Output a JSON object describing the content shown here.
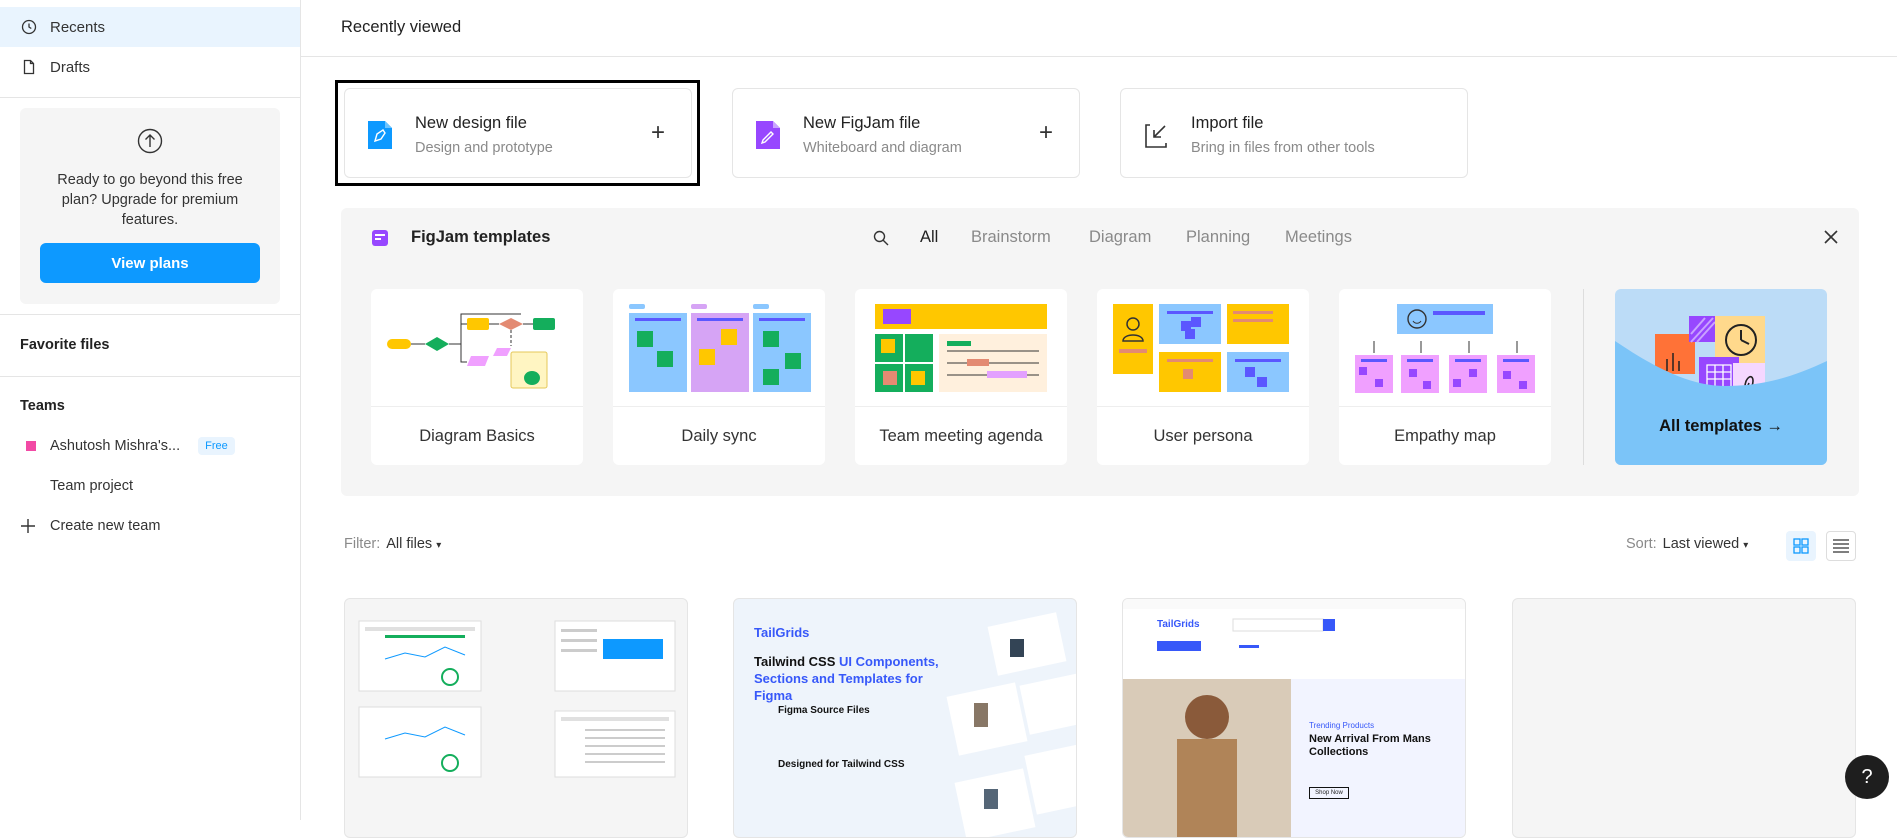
{
  "sidebar": {
    "nav": [
      {
        "label": "Recents",
        "icon": "clock-icon"
      },
      {
        "label": "Drafts",
        "icon": "file-icon"
      }
    ],
    "upgrade": {
      "text": "Ready to go beyond this free plan? Upgrade for premium features.",
      "button": "View plans"
    },
    "favorites_title": "Favorite files",
    "teams_title": "Teams",
    "teams": [
      {
        "name": "Ashutosh Mishra's...",
        "badge": "Free",
        "color": "#f24aa5"
      },
      {
        "name": "Team project"
      }
    ],
    "create_team": "Create new team"
  },
  "header": {
    "title": "Recently viewed"
  },
  "new_files": [
    {
      "title": "New design file",
      "subtitle": "Design and prototype",
      "icon": "design-file-icon",
      "color": "#0d99ff"
    },
    {
      "title": "New FigJam file",
      "subtitle": "Whiteboard and diagram",
      "icon": "figjam-file-icon",
      "color": "#9747ff"
    },
    {
      "title": "Import file",
      "subtitle": "Bring in files from other tools",
      "icon": "import-icon"
    }
  ],
  "templates": {
    "title": "FigJam templates",
    "tabs": [
      "All",
      "Brainstorm",
      "Diagram",
      "Planning",
      "Meetings"
    ],
    "active_tab": "All",
    "cards": [
      "Diagram Basics",
      "Daily sync",
      "Team meeting agenda",
      "User persona",
      "Empathy map"
    ],
    "all_templates": "All templates →"
  },
  "filter": {
    "label": "Filter:",
    "value": "All files"
  },
  "sort": {
    "label": "Sort:",
    "value": "Last viewed"
  },
  "files_thumbs": [
    {
      "name": "dashboard-thumbnail"
    },
    {
      "name": "tailgrids-thumbnail",
      "brand": "TailGrids",
      "headline_a": "Tailwind CSS ",
      "headline_b": "UI Components, Sections and Templates for Figma",
      "item1": "Figma Source Files",
      "item2": "Designed for Tailwind CSS"
    },
    {
      "name": "ecommerce-thumbnail",
      "brand": "TailGrids",
      "tag": "Trending Products",
      "headline": "New Arrival From Mans Collections",
      "button": "Shop Now"
    },
    {
      "name": "empty-thumbnail"
    }
  ],
  "help": "?"
}
